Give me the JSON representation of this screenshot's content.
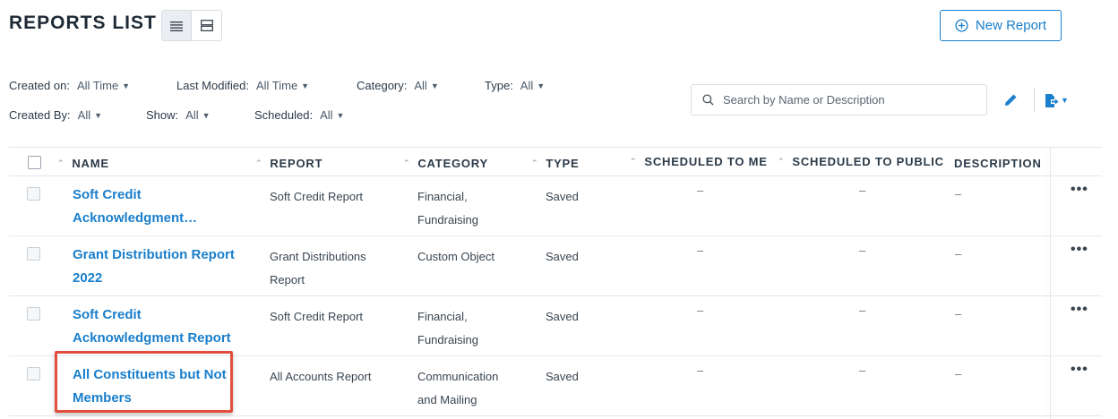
{
  "header": {
    "title": "REPORTS LIST",
    "new_report_label": "New Report"
  },
  "filters": [
    {
      "label": "Created on:",
      "value": "All Time"
    },
    {
      "label": "Last Modified:",
      "value": "All Time"
    },
    {
      "label": "Category:",
      "value": "All"
    },
    {
      "label": "Type:",
      "value": "All"
    },
    {
      "label": "Created By:",
      "value": "All"
    },
    {
      "label": "Show:",
      "value": "All"
    },
    {
      "label": "Scheduled:",
      "value": "All"
    }
  ],
  "search": {
    "placeholder": "Search by Name or Description"
  },
  "table": {
    "columns": [
      "NAME",
      "REPORT",
      "CATEGORY",
      "TYPE",
      "SCHEDULED TO ME",
      "SCHEDULED TO PUBLIC",
      "DESCRIPTION"
    ],
    "rows": [
      {
        "name": "Soft Credit Acknowledgment…",
        "report": "Soft Credit Report",
        "category": "Financial, Fundraising",
        "type": "Saved",
        "scheduled_me": "–",
        "scheduled_public": "–",
        "description": "–"
      },
      {
        "name": "Grant Distribution Report 2022",
        "report": "Grant Distributions Report",
        "category": "Custom Object",
        "type": "Saved",
        "scheduled_me": "–",
        "scheduled_public": "–",
        "description": "–"
      },
      {
        "name": "Soft Credit Acknowledgment Report",
        "report": "Soft Credit Report",
        "category": "Financial, Fundraising",
        "type": "Saved",
        "scheduled_me": "–",
        "scheduled_public": "–",
        "description": "–"
      },
      {
        "name": "All Constituents but Not Members",
        "report": "All Accounts Report",
        "category": "Communication and Mailing",
        "type": "Saved",
        "scheduled_me": "–",
        "scheduled_public": "–",
        "description": "–"
      }
    ],
    "row_menu_label": "•••"
  },
  "colors": {
    "accent": "#1a7fcc",
    "highlight": "#e2503d",
    "title": "#1e2a36"
  },
  "icons": {
    "list_view": "list-view-icon",
    "card_view": "card-view-icon",
    "new": "plus-circle-icon",
    "search": "search-icon",
    "edit": "pencil-icon",
    "export": "export-icon"
  }
}
